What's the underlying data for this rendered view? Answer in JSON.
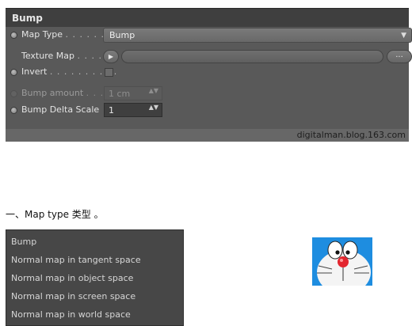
{
  "panel": {
    "title": "Bump",
    "map_type": {
      "label": "Map Type",
      "dots": ". . . . . .",
      "value": "Bump",
      "arrow": "▼"
    },
    "texture_map": {
      "label": "Texture Map",
      "dots": ". . . .",
      "play_glyph": "▶",
      "more_label": "..."
    },
    "invert": {
      "label": "Invert",
      "dots": ". . . . . . . . . .",
      "checked": false
    },
    "bump_amount": {
      "label": "Bump amount",
      "dots": ". . .",
      "value": "1 cm",
      "enabled": false
    },
    "bump_delta_scale": {
      "label": "Bump Delta Scale",
      "value": "1"
    },
    "spinner_glyph": "▲▼",
    "watermark": "digitalman.blog.163.com"
  },
  "section_heading": "一、Map type  类型 。",
  "map_type_options": [
    "Bump",
    "Normal map in tangent space",
    "Normal map in object space",
    "Normal map in screen space",
    "Normal map in world space"
  ],
  "colors": {
    "panel_bg": "#595959",
    "header_bg": "#3f3f3f",
    "list_bg": "#474747",
    "image_blue": "#1e8de0"
  }
}
